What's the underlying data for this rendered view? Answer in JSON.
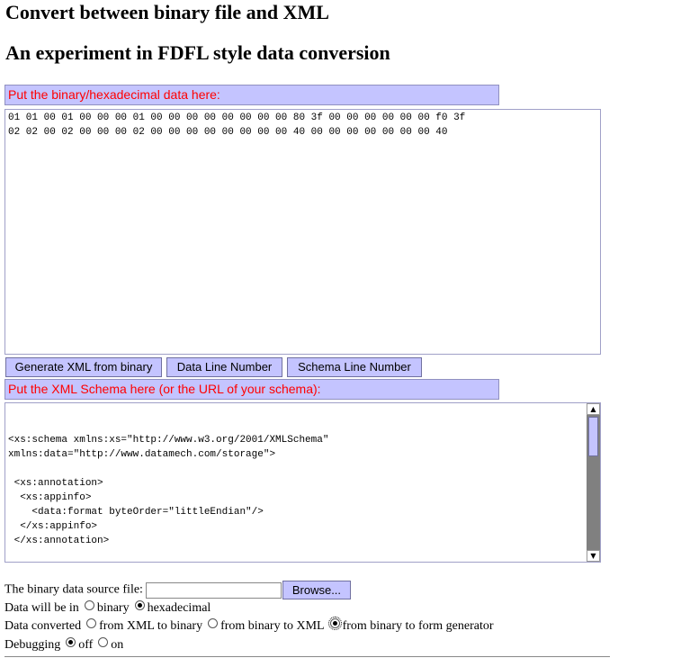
{
  "page": {
    "title": "Convert between binary file and XML",
    "subtitle": "An experiment in FDFL style data conversion"
  },
  "hex_section": {
    "label": "Put the binary/hexadecimal data here:",
    "content": "01 01 00 01 00 00 00 01 00 00 00 00 00 00 00 00 80 3f 00 00 00 00 00 00 f0 3f\n02 02 00 02 00 00 00 02 00 00 00 00 00 00 00 00 40 00 00 00 00 00 00 00 40"
  },
  "buttons": {
    "generate": "Generate XML from binary",
    "data_line": "Data Line Number",
    "schema_line": "Schema Line Number"
  },
  "schema_section": {
    "label": "Put the XML Schema here (or the URL of your schema):",
    "content": "<xs:schema xmlns:xs=\"http://www.w3.org/2001/XMLSchema\"\nxmlns:data=\"http://www.datamech.com/storage\">\n\n <xs:annotation>\n  <xs:appinfo>\n    <data:format byteOrder=\"littleEndian\"/>\n  </xs:appinfo>\n </xs:annotation>\n\n <xs:element name=\"sextet\">\n  <xs:complexType>"
  },
  "form": {
    "file_label": "The binary data source file:",
    "browse_label": "Browse...",
    "format_label": "Data will be in",
    "format_options": [
      "binary",
      "hexadecimal"
    ],
    "format_selected": "hexadecimal",
    "convert_label": "Data converted",
    "convert_options": [
      "from XML to binary",
      "from binary to XML",
      "from binary to form generator"
    ],
    "convert_selected": "from binary to form generator",
    "debug_label": "Debugging",
    "debug_options": [
      "off",
      "on"
    ],
    "debug_selected": "off"
  }
}
